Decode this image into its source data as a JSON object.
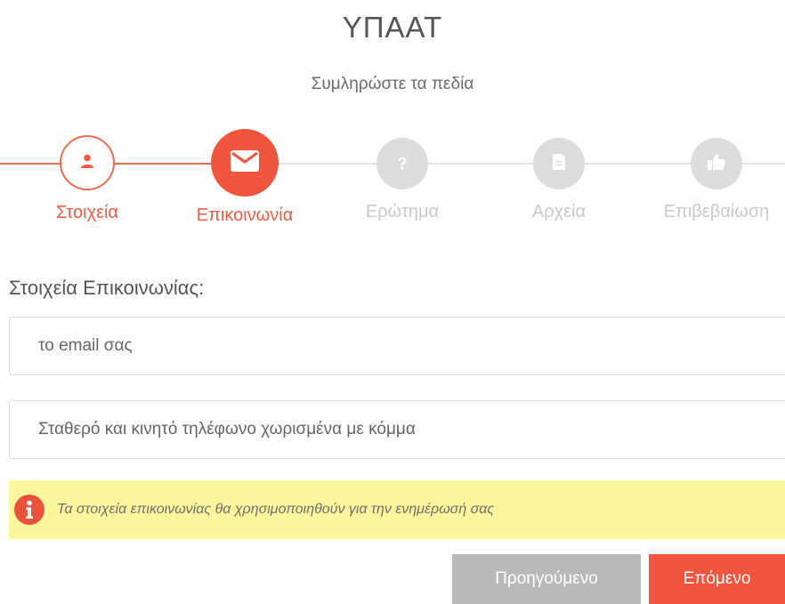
{
  "header": {
    "title": "ΥΠΑΑΤ",
    "subtitle": "Συμληρώστε τα πεδία"
  },
  "stepper": {
    "steps": [
      {
        "label": "Στοιχεία",
        "icon": "user-icon",
        "state": "completed"
      },
      {
        "label": "Επικοινωνία",
        "icon": "envelope-icon",
        "state": "current"
      },
      {
        "label": "Ερώτημα",
        "icon": "question-icon",
        "state": "pending"
      },
      {
        "label": "Αρχεία",
        "icon": "document-icon",
        "state": "pending"
      },
      {
        "label": "Επιβεβαίωση",
        "icon": "thumbs-up-icon",
        "state": "pending"
      }
    ]
  },
  "form": {
    "section_title": "Στοιχεία Επικοινωνίας:",
    "email": {
      "value": "",
      "placeholder": "το email σας"
    },
    "phone": {
      "value": "",
      "placeholder": "Σταθερό και κινητό τηλέφωνο χωρισμένα με κόμμα"
    },
    "notice": {
      "icon": "info-icon",
      "text": "Τα στοιχεία επικοινωνίας θα χρησιμοποιηθούν για την ενημέρωσή σας"
    }
  },
  "actions": {
    "previous_label": "Προηγούμενο",
    "next_label": "Επόμενο"
  },
  "colors": {
    "accent": "#f0563d",
    "inactive": "#dcdcdc",
    "notice_bg": "#fdf69c",
    "prev_button": "#b9b9b9"
  }
}
